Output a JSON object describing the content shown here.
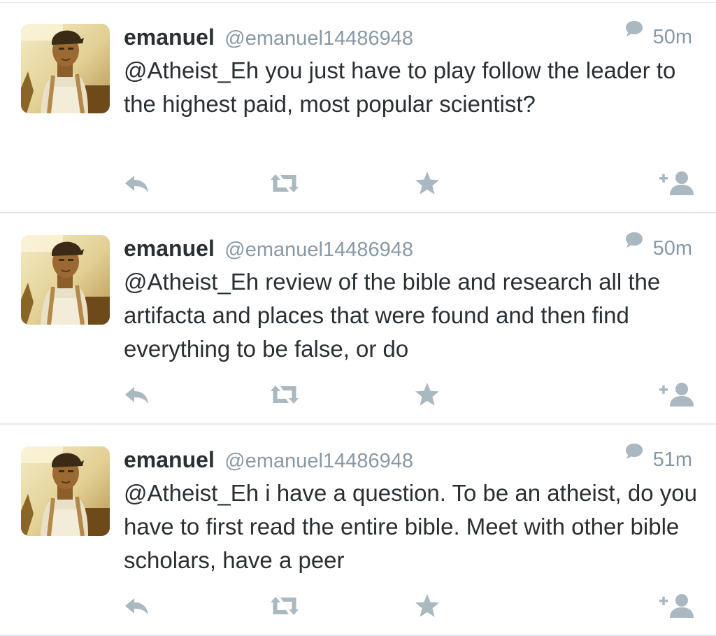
{
  "timeline": {
    "tweets": [
      {
        "name": "emanuel",
        "handle": "@emanuel14486948",
        "time": "50m",
        "text": "@Atheist_Eh you just have to play follow the leader to the highest paid, most popular scientist?"
      },
      {
        "name": "emanuel",
        "handle": "@emanuel14486948",
        "time": "50m",
        "text": "@Atheist_Eh review of the bible and research all the artifacta and places that were found and then find everything to be false, or do"
      },
      {
        "name": "emanuel",
        "handle": "@emanuel14486948",
        "time": "51m",
        "text": "@Atheist_Eh i have a question. To be an atheist, do you have to first read the entire bible. Meet with other bible scholars, have a peer"
      }
    ],
    "icons": {
      "reply": "reply-icon",
      "retweet": "retweet-icon",
      "favorite": "star-icon",
      "follow": "add-user-icon",
      "conversation": "speech-bubble-icon"
    },
    "colors": {
      "name": "#292f33",
      "meta": "#8899a6",
      "icon": "#aab8c2",
      "divider": "#e1e8ed",
      "avatar_tint": "#b08a3c"
    }
  }
}
